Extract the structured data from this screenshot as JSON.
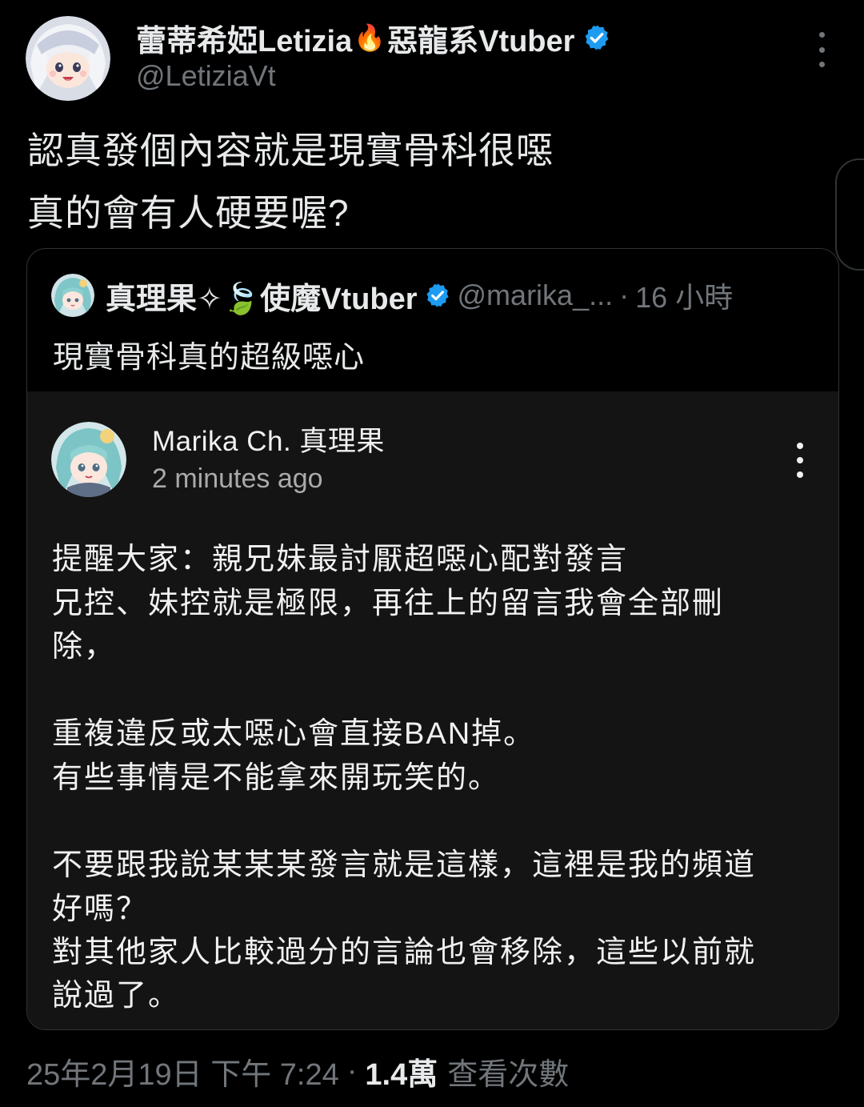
{
  "tweet": {
    "author": {
      "name_part1": "蕾蒂希婭Letizia",
      "fire_emoji": "🔥",
      "name_part2": "惡龍系Vtuber",
      "handle": "@LetiziaVt",
      "verified": true,
      "avatar_icon": "anime-avatar-white-hair"
    },
    "text_lines": [
      "認真發個內容就是現實骨科很噁",
      "真的會有人硬要喔?"
    ],
    "more_icon": "more-vertical-icon"
  },
  "quote": {
    "author_name": "真理果✧🍃使魔Vtuber",
    "handle": "@marika_...",
    "separator": "·",
    "time": "16 小時",
    "verified": true,
    "avatar_icon": "anime-avatar-teal-hair",
    "text": "現實骨科真的超級噁心",
    "embedded_comment": {
      "author": "Marika Ch. 真理果",
      "time": "2 minutes ago",
      "avatar_icon": "anime-avatar-teal-hair",
      "more_icon": "more-vertical-icon",
      "lines": [
        "提醒大家：親兄妹最討厭超噁心配對發言",
        "兄控、妹控就是極限，再往上的留言我會全部刪",
        "除，",
        "",
        "重複違反或太噁心會直接BAN掉。",
        "有些事情是不能拿來開玩笑的。",
        "",
        "不要跟我說某某某發言就是這樣，這裡是我的頻道",
        "好嗎？",
        "對其他家人比較過分的言論也會移除，這些以前就",
        "說過了。"
      ]
    }
  },
  "footer": {
    "date": "25年2月19日 下午 7:24",
    "separator": "·",
    "views_count": "1.4萬",
    "views_label": "查看次數"
  },
  "colors": {
    "background": "#000000",
    "text_primary": "#e7e9ea",
    "text_secondary": "#71767b",
    "verified_blue": "#1d9bf0",
    "card_border": "#2f3336",
    "embedded_bg": "#141414"
  }
}
